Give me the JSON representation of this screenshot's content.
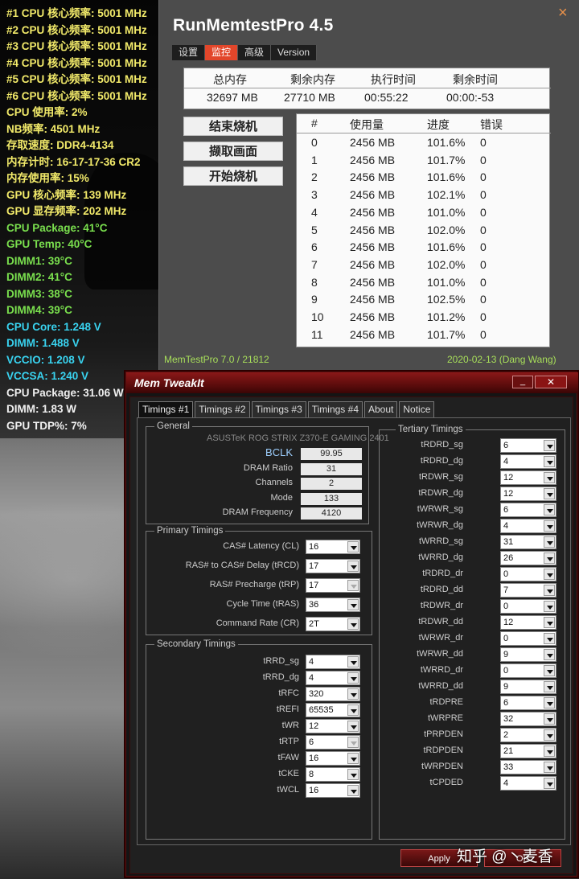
{
  "osd": [
    {
      "text": "#1 CPU 核心频率: 5001 MHz",
      "color": "yellow"
    },
    {
      "text": "#2 CPU 核心频率: 5001 MHz",
      "color": "yellow"
    },
    {
      "text": "#3 CPU 核心频率: 5001 MHz",
      "color": "yellow"
    },
    {
      "text": "#4 CPU 核心频率: 5001 MHz",
      "color": "yellow"
    },
    {
      "text": "#5 CPU 核心频率: 5001 MHz",
      "color": "yellow"
    },
    {
      "text": "#6 CPU 核心频率: 5001 MHz",
      "color": "yellow"
    },
    {
      "text": "CPU 使用率: 2%",
      "color": "yellow"
    },
    {
      "text": "NB频率: 4501 MHz",
      "color": "yellow"
    },
    {
      "text": "存取速度: DDR4-4134",
      "color": "yellow"
    },
    {
      "text": "内存计时: 16-17-17-36 CR2",
      "color": "yellow"
    },
    {
      "text": "内存使用率: 15%",
      "color": "yellow"
    },
    {
      "text": "GPU 核心频率: 139 MHz",
      "color": "yellow"
    },
    {
      "text": "GPU 显存频率: 202 MHz",
      "color": "yellow"
    },
    {
      "text": "CPU Package: 41°C",
      "color": "green"
    },
    {
      "text": "GPU Temp: 40°C",
      "color": "green"
    },
    {
      "text": "DIMM1: 39°C",
      "color": "green"
    },
    {
      "text": "DIMM2: 41°C",
      "color": "green"
    },
    {
      "text": "DIMM3: 38°C",
      "color": "green"
    },
    {
      "text": "DIMM4: 39°C",
      "color": "green"
    },
    {
      "text": "CPU Core: 1.248 V",
      "color": "cyan"
    },
    {
      "text": "DIMM: 1.488 V",
      "color": "cyan"
    },
    {
      "text": "VCCIO: 1.208 V",
      "color": "cyan"
    },
    {
      "text": "VCCSA: 1.240 V",
      "color": "cyan"
    },
    {
      "text": "CPU Package: 31.06 W",
      "color": "white"
    },
    {
      "text": "DIMM: 1.83 W",
      "color": "white"
    },
    {
      "text": "GPU TDP%: 7%",
      "color": "white"
    }
  ],
  "rmt": {
    "title": "RunMemtestPro 4.5",
    "close_icon": "×",
    "tabs": [
      "设置",
      "监控",
      "高级",
      "Version"
    ],
    "active_tab": 1,
    "summary_headers": [
      "总内存",
      "剩余内存",
      "执行时间",
      "剩余时间"
    ],
    "summary_values": [
      "32697 MB",
      "27710 MB",
      "00:55:22",
      "00:00:-53"
    ],
    "buttons": [
      "结束烧机",
      "撷取画面",
      "开始烧机"
    ],
    "grid_headers": [
      "#",
      "使用量",
      "进度",
      "错误"
    ],
    "rows": [
      [
        "0",
        "2456 MB",
        "101.6%",
        "0"
      ],
      [
        "1",
        "2456 MB",
        "101.7%",
        "0"
      ],
      [
        "2",
        "2456 MB",
        "101.6%",
        "0"
      ],
      [
        "3",
        "2456 MB",
        "102.1%",
        "0"
      ],
      [
        "4",
        "2456 MB",
        "101.0%",
        "0"
      ],
      [
        "5",
        "2456 MB",
        "102.0%",
        "0"
      ],
      [
        "6",
        "2456 MB",
        "101.6%",
        "0"
      ],
      [
        "7",
        "2456 MB",
        "102.0%",
        "0"
      ],
      [
        "8",
        "2456 MB",
        "101.0%",
        "0"
      ],
      [
        "9",
        "2456 MB",
        "102.5%",
        "0"
      ],
      [
        "10",
        "2456 MB",
        "101.2%",
        "0"
      ],
      [
        "11",
        "2456 MB",
        "101.7%",
        "0"
      ]
    ],
    "footer_left": "MemTestPro 7.0 / 21812",
    "footer_right": "2020-02-13 (Dang Wang)"
  },
  "mti": {
    "title": "Mem TweakIt",
    "min_label": "_",
    "close_label": "✕",
    "tabs": [
      "Timings #1",
      "Timings #2",
      "Timings #3",
      "Timings #4",
      "About",
      "Notice"
    ],
    "active_tab": 0,
    "general": {
      "title": "General",
      "model": "ASUSTeK ROG STRIX Z370-E GAMING 2401",
      "fields": [
        {
          "label": "BCLK",
          "value": "99.95"
        },
        {
          "label": "DRAM Ratio",
          "value": "31"
        },
        {
          "label": "Channels",
          "value": "2"
        },
        {
          "label": "Mode",
          "value": "133"
        },
        {
          "label": "DRAM Frequency",
          "value": "4120"
        }
      ]
    },
    "primary": {
      "title": "Primary Timings",
      "fields": [
        {
          "label": "CAS# Latency (CL)",
          "value": "16",
          "enabled": true
        },
        {
          "label": "RAS# to CAS# Delay (tRCD)",
          "value": "17",
          "enabled": true
        },
        {
          "label": "RAS# Precharge (tRP)",
          "value": "17",
          "enabled": false
        },
        {
          "label": "Cycle Time (tRAS)",
          "value": "36",
          "enabled": true
        },
        {
          "label": "Command Rate (CR)",
          "value": "2T",
          "enabled": true
        }
      ]
    },
    "secondary": {
      "title": "Secondary Timings",
      "fields": [
        {
          "label": "tRRD_sg",
          "value": "4",
          "enabled": true
        },
        {
          "label": "tRRD_dg",
          "value": "4",
          "enabled": true
        },
        {
          "label": "tRFC",
          "value": "320",
          "enabled": true
        },
        {
          "label": "tREFI",
          "value": "65535",
          "enabled": true
        },
        {
          "label": "tWR",
          "value": "12",
          "enabled": true
        },
        {
          "label": "tRTP",
          "value": "6",
          "enabled": false
        },
        {
          "label": "tFAW",
          "value": "16",
          "enabled": true
        },
        {
          "label": "tCKE",
          "value": "8",
          "enabled": true
        },
        {
          "label": "tWCL",
          "value": "16",
          "enabled": true
        }
      ]
    },
    "tertiary": {
      "title": "Tertiary Timings",
      "fields": [
        {
          "label": "tRDRD_sg",
          "value": "6"
        },
        {
          "label": "tRDRD_dg",
          "value": "4"
        },
        {
          "label": "tRDWR_sg",
          "value": "12"
        },
        {
          "label": "tRDWR_dg",
          "value": "12"
        },
        {
          "label": "tWRWR_sg",
          "value": "6"
        },
        {
          "label": "tWRWR_dg",
          "value": "4"
        },
        {
          "label": "tWRRD_sg",
          "value": "31"
        },
        {
          "label": "tWRRD_dg",
          "value": "26"
        },
        {
          "label": "tRDRD_dr",
          "value": "0"
        },
        {
          "label": "tRDRD_dd",
          "value": "7"
        },
        {
          "label": "tRDWR_dr",
          "value": "0"
        },
        {
          "label": "tRDWR_dd",
          "value": "12"
        },
        {
          "label": "tWRWR_dr",
          "value": "0"
        },
        {
          "label": "tWRWR_dd",
          "value": "9"
        },
        {
          "label": "tWRRD_dr",
          "value": "0"
        },
        {
          "label": "tWRRD_dd",
          "value": "9"
        },
        {
          "label": "tRDPRE",
          "value": "6"
        },
        {
          "label": "tWRPRE",
          "value": "32"
        },
        {
          "label": "tPRPDEN",
          "value": "2"
        },
        {
          "label": "tRDPDEN",
          "value": "21"
        },
        {
          "label": "tWRPDEN",
          "value": "33"
        },
        {
          "label": "tCPDED",
          "value": "4"
        }
      ]
    },
    "apply_label": "Apply",
    "ok_label": "OK"
  },
  "watermark": "知乎 @丶麦香"
}
